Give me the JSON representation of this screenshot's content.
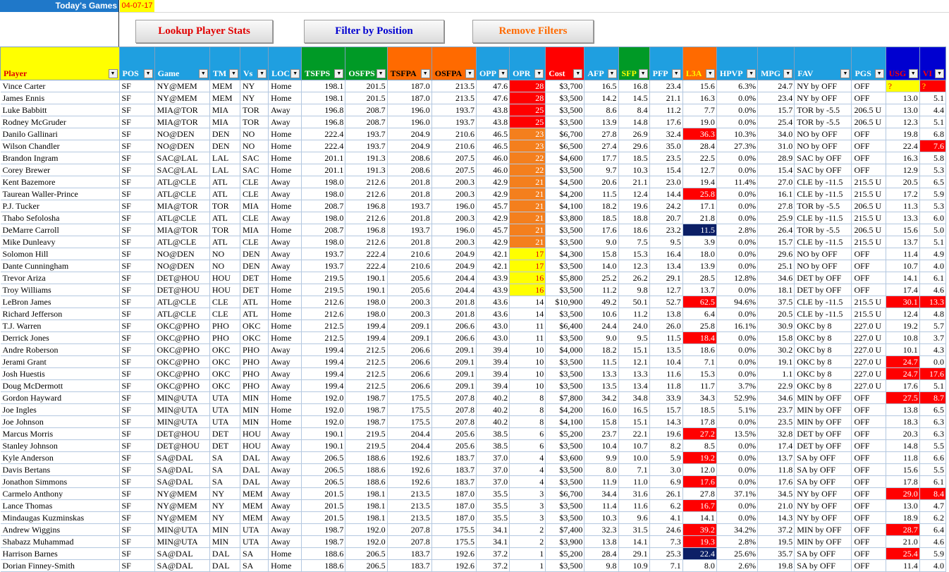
{
  "header": {
    "title": "Today's Games",
    "date": "04-07-17"
  },
  "buttons": {
    "lookup": "Lookup Player Stats",
    "filter": "Filter by Position",
    "remove": "Remove Filters"
  },
  "columns": [
    "Player",
    "POS",
    "Game",
    "TM",
    "Vs",
    "LOC",
    "TSFPS",
    "OSFPS",
    "TSFPA",
    "OSFPA",
    "OPP",
    "OPR",
    "Cost",
    "AFP",
    "SFP",
    "PFP",
    "L3A",
    "HPVP",
    "MPG",
    "FAV",
    "PGS",
    "USG",
    "VI"
  ],
  "column_colors": {
    "yellow": "#ffff00",
    "blue": "#1f9fe0",
    "green": "#009a26",
    "orange": "#ff6a00",
    "red": "#ff0000",
    "navy": "#0000d0"
  },
  "rows": [
    [
      "Vince Carter",
      "SF",
      "NY@MEM",
      "MEM",
      "NY",
      "Home",
      "198.1",
      "201.5",
      "187.0",
      "213.5",
      "47.6",
      "28",
      "$3,700",
      "16.5",
      "16.8",
      "23.4",
      "15.6",
      "6.3%",
      "24.7",
      "NY by OFF",
      "OFF",
      "?",
      "?"
    ],
    [
      "James Ennis",
      "SF",
      "NY@MEM",
      "MEM",
      "NY",
      "Home",
      "198.1",
      "201.5",
      "187.0",
      "213.5",
      "47.6",
      "28",
      "$3,500",
      "14.2",
      "14.5",
      "21.1",
      "16.3",
      "0.0%",
      "23.4",
      "NY by OFF",
      "OFF",
      "13.0",
      "5.1"
    ],
    [
      "Luke Babbitt",
      "SF",
      "MIA@TOR",
      "MIA",
      "TOR",
      "Away",
      "196.8",
      "208.7",
      "196.0",
      "193.7",
      "43.8",
      "25",
      "$3,500",
      "8.6",
      "8.4",
      "11.2",
      "7.7",
      "0.0%",
      "15.7",
      "TOR by -5.5",
      "206.5 U",
      "13.0",
      "4.4"
    ],
    [
      "Rodney McGruder",
      "SF",
      "MIA@TOR",
      "MIA",
      "TOR",
      "Away",
      "196.8",
      "208.7",
      "196.0",
      "193.7",
      "43.8",
      "25",
      "$3,500",
      "13.9",
      "14.8",
      "17.6",
      "19.0",
      "0.0%",
      "25.4",
      "TOR by -5.5",
      "206.5 U",
      "12.3",
      "5.1"
    ],
    [
      "Danilo Gallinari",
      "SF",
      "NO@DEN",
      "DEN",
      "NO",
      "Home",
      "222.4",
      "193.7",
      "204.9",
      "210.6",
      "46.5",
      "23",
      "$6,700",
      "27.8",
      "26.9",
      "32.4",
      "36.3",
      "10.3%",
      "34.0",
      "NO by OFF",
      "OFF",
      "19.8",
      "6.8"
    ],
    [
      "Wilson Chandler",
      "SF",
      "NO@DEN",
      "DEN",
      "NO",
      "Home",
      "222.4",
      "193.7",
      "204.9",
      "210.6",
      "46.5",
      "23",
      "$6,500",
      "27.4",
      "29.6",
      "35.0",
      "28.4",
      "27.3%",
      "31.0",
      "NO by OFF",
      "OFF",
      "22.4",
      "7.6"
    ],
    [
      "Brandon Ingram",
      "SF",
      "SAC@LAL",
      "LAL",
      "SAC",
      "Home",
      "201.1",
      "191.3",
      "208.6",
      "207.5",
      "46.0",
      "22",
      "$4,600",
      "17.7",
      "18.5",
      "23.5",
      "22.5",
      "0.0%",
      "28.9",
      "SAC by OFF",
      "OFF",
      "16.3",
      "5.8"
    ],
    [
      "Corey Brewer",
      "SF",
      "SAC@LAL",
      "LAL",
      "SAC",
      "Home",
      "201.1",
      "191.3",
      "208.6",
      "207.5",
      "46.0",
      "22",
      "$3,500",
      "9.7",
      "10.3",
      "15.4",
      "12.7",
      "0.0%",
      "15.4",
      "SAC by OFF",
      "OFF",
      "12.9",
      "5.3"
    ],
    [
      "Kent Bazemore",
      "SF",
      "ATL@CLE",
      "ATL",
      "CLE",
      "Away",
      "198.0",
      "212.6",
      "201.8",
      "200.3",
      "42.9",
      "21",
      "$4,500",
      "20.6",
      "21.1",
      "23.0",
      "19.4",
      "11.4%",
      "27.0",
      "CLE by -11.5",
      "215.5 U",
      "20.5",
      "6.5"
    ],
    [
      "Taurean Waller-Prince",
      "SF",
      "ATL@CLE",
      "ATL",
      "CLE",
      "Away",
      "198.0",
      "212.6",
      "201.8",
      "200.3",
      "42.9",
      "21",
      "$4,200",
      "11.5",
      "12.4",
      "14.4",
      "25.8",
      "0.0%",
      "16.1",
      "CLE by -11.5",
      "215.5 U",
      "17.2",
      "5.9"
    ],
    [
      "P.J. Tucker",
      "SF",
      "MIA@TOR",
      "TOR",
      "MIA",
      "Home",
      "208.7",
      "196.8",
      "193.7",
      "196.0",
      "45.7",
      "21",
      "$4,100",
      "18.2",
      "19.6",
      "24.2",
      "17.1",
      "0.0%",
      "27.8",
      "TOR by -5.5",
      "206.5 U",
      "11.3",
      "5.3"
    ],
    [
      "Thabo Sefolosha",
      "SF",
      "ATL@CLE",
      "ATL",
      "CLE",
      "Away",
      "198.0",
      "212.6",
      "201.8",
      "200.3",
      "42.9",
      "21",
      "$3,800",
      "18.5",
      "18.8",
      "20.7",
      "21.8",
      "0.0%",
      "25.9",
      "CLE by -11.5",
      "215.5 U",
      "13.3",
      "6.0"
    ],
    [
      "DeMarre Carroll",
      "SF",
      "MIA@TOR",
      "TOR",
      "MIA",
      "Home",
      "208.7",
      "196.8",
      "193.7",
      "196.0",
      "45.7",
      "21",
      "$3,500",
      "17.6",
      "18.6",
      "23.2",
      "11.5",
      "2.8%",
      "26.4",
      "TOR by -5.5",
      "206.5 U",
      "15.6",
      "5.0"
    ],
    [
      "Mike Dunleavy",
      "SF",
      "ATL@CLE",
      "ATL",
      "CLE",
      "Away",
      "198.0",
      "212.6",
      "201.8",
      "200.3",
      "42.9",
      "21",
      "$3,500",
      "9.0",
      "7.5",
      "9.5",
      "3.9",
      "0.0%",
      "15.7",
      "CLE by -11.5",
      "215.5 U",
      "13.7",
      "5.1"
    ],
    [
      "Solomon Hill",
      "SF",
      "NO@DEN",
      "NO",
      "DEN",
      "Away",
      "193.7",
      "222.4",
      "210.6",
      "204.9",
      "42.1",
      "17",
      "$4,300",
      "15.8",
      "15.3",
      "16.4",
      "18.0",
      "0.0%",
      "29.6",
      "NO by OFF",
      "OFF",
      "11.4",
      "4.9"
    ],
    [
      "Dante Cunningham",
      "SF",
      "NO@DEN",
      "NO",
      "DEN",
      "Away",
      "193.7",
      "222.4",
      "210.6",
      "204.9",
      "42.1",
      "17",
      "$3,500",
      "14.0",
      "12.3",
      "13.4",
      "13.9",
      "0.0%",
      "25.1",
      "NO by OFF",
      "OFF",
      "10.7",
      "4.0"
    ],
    [
      "Trevor Ariza",
      "SF",
      "DET@HOU",
      "HOU",
      "DET",
      "Home",
      "219.5",
      "190.1",
      "205.6",
      "204.4",
      "43.9",
      "16",
      "$5,800",
      "25.2",
      "26.2",
      "29.1",
      "28.5",
      "12.8%",
      "34.6",
      "DET by OFF",
      "OFF",
      "14.1",
      "6.1"
    ],
    [
      "Troy Williams",
      "SF",
      "DET@HOU",
      "HOU",
      "DET",
      "Home",
      "219.5",
      "190.1",
      "205.6",
      "204.4",
      "43.9",
      "16",
      "$3,500",
      "11.2",
      "9.8",
      "12.7",
      "13.7",
      "0.0%",
      "18.1",
      "DET by OFF",
      "OFF",
      "17.4",
      "4.6"
    ],
    [
      "LeBron James",
      "SF",
      "ATL@CLE",
      "CLE",
      "ATL",
      "Home",
      "212.6",
      "198.0",
      "200.3",
      "201.8",
      "43.6",
      "14",
      "$10,900",
      "49.2",
      "50.1",
      "52.7",
      "62.5",
      "94.6%",
      "37.5",
      "CLE by -11.5",
      "215.5 U",
      "30.1",
      "13.3"
    ],
    [
      "Richard Jefferson",
      "SF",
      "ATL@CLE",
      "CLE",
      "ATL",
      "Home",
      "212.6",
      "198.0",
      "200.3",
      "201.8",
      "43.6",
      "14",
      "$3,500",
      "10.6",
      "11.2",
      "13.8",
      "6.4",
      "0.0%",
      "20.5",
      "CLE by -11.5",
      "215.5 U",
      "12.4",
      "4.8"
    ],
    [
      "T.J. Warren",
      "SF",
      "OKC@PHO",
      "PHO",
      "OKC",
      "Home",
      "212.5",
      "199.4",
      "209.1",
      "206.6",
      "43.0",
      "11",
      "$6,400",
      "24.4",
      "24.0",
      "26.0",
      "25.8",
      "16.1%",
      "30.9",
      "OKC by 8",
      "227.0 U",
      "19.2",
      "5.7"
    ],
    [
      "Derrick Jones",
      "SF",
      "OKC@PHO",
      "PHO",
      "OKC",
      "Home",
      "212.5",
      "199.4",
      "209.1",
      "206.6",
      "43.0",
      "11",
      "$3,500",
      "9.0",
      "9.5",
      "11.5",
      "18.4",
      "0.0%",
      "15.8",
      "OKC by 8",
      "227.0 U",
      "10.8",
      "3.7"
    ],
    [
      "Andre Roberson",
      "SF",
      "OKC@PHO",
      "OKC",
      "PHO",
      "Away",
      "199.4",
      "212.5",
      "206.6",
      "209.1",
      "39.4",
      "10",
      "$4,000",
      "18.2",
      "15.1",
      "13.5",
      "18.6",
      "0.0%",
      "30.2",
      "OKC by 8",
      "227.0 U",
      "10.1",
      "4.3"
    ],
    [
      "Jerami Grant",
      "SF",
      "OKC@PHO",
      "OKC",
      "PHO",
      "Away",
      "199.4",
      "212.5",
      "206.6",
      "209.1",
      "39.4",
      "10",
      "$3,500",
      "11.5",
      "12.1",
      "10.4",
      "7.1",
      "0.0%",
      "19.1",
      "OKC by 8",
      "227.0 U",
      "24.7",
      "0.0"
    ],
    [
      "Josh Huestis",
      "SF",
      "OKC@PHO",
      "OKC",
      "PHO",
      "Away",
      "199.4",
      "212.5",
      "206.6",
      "209.1",
      "39.4",
      "10",
      "$3,500",
      "13.3",
      "13.3",
      "11.6",
      "15.3",
      "0.0%",
      "1.1",
      "OKC by 8",
      "227.0 U",
      "24.7",
      "17.6"
    ],
    [
      "Doug McDermott",
      "SF",
      "OKC@PHO",
      "OKC",
      "PHO",
      "Away",
      "199.4",
      "212.5",
      "206.6",
      "209.1",
      "39.4",
      "10",
      "$3,500",
      "13.5",
      "13.4",
      "11.8",
      "11.7",
      "3.7%",
      "22.9",
      "OKC by 8",
      "227.0 U",
      "17.6",
      "5.1"
    ],
    [
      "Gordon Hayward",
      "SF",
      "MIN@UTA",
      "UTA",
      "MIN",
      "Home",
      "192.0",
      "198.7",
      "175.5",
      "207.8",
      "40.2",
      "8",
      "$7,800",
      "34.2",
      "34.8",
      "33.9",
      "34.3",
      "52.9%",
      "34.6",
      "MIN by OFF",
      "OFF",
      "27.5",
      "8.7"
    ],
    [
      "Joe Ingles",
      "SF",
      "MIN@UTA",
      "UTA",
      "MIN",
      "Home",
      "192.0",
      "198.7",
      "175.5",
      "207.8",
      "40.2",
      "8",
      "$4,200",
      "16.0",
      "16.5",
      "15.7",
      "18.5",
      "5.1%",
      "23.7",
      "MIN by OFF",
      "OFF",
      "13.8",
      "6.5"
    ],
    [
      "Joe Johnson",
      "SF",
      "MIN@UTA",
      "UTA",
      "MIN",
      "Home",
      "192.0",
      "198.7",
      "175.5",
      "207.8",
      "40.2",
      "8",
      "$4,100",
      "15.8",
      "15.1",
      "14.3",
      "17.8",
      "0.0%",
      "23.5",
      "MIN by OFF",
      "OFF",
      "18.3",
      "6.3"
    ],
    [
      "Marcus Morris",
      "SF",
      "DET@HOU",
      "DET",
      "HOU",
      "Away",
      "190.1",
      "219.5",
      "204.4",
      "205.6",
      "38.5",
      "6",
      "$5,200",
      "23.7",
      "22.1",
      "19.6",
      "27.2",
      "13.5%",
      "32.8",
      "DET by OFF",
      "OFF",
      "20.3",
      "6.3"
    ],
    [
      "Stanley Johnson",
      "SF",
      "DET@HOU",
      "DET",
      "HOU",
      "Away",
      "190.1",
      "219.5",
      "204.4",
      "205.6",
      "38.5",
      "6",
      "$3,500",
      "10.4",
      "10.7",
      "8.2",
      "8.5",
      "0.0%",
      "17.4",
      "DET by OFF",
      "OFF",
      "14.8",
      "5.5"
    ],
    [
      "Kyle Anderson",
      "SF",
      "SA@DAL",
      "SA",
      "DAL",
      "Away",
      "206.5",
      "188.6",
      "192.6",
      "183.7",
      "37.0",
      "4",
      "$3,600",
      "9.9",
      "10.0",
      "5.9",
      "19.2",
      "0.0%",
      "13.7",
      "SA by OFF",
      "OFF",
      "11.8",
      "6.6"
    ],
    [
      "Davis Bertans",
      "SF",
      "SA@DAL",
      "SA",
      "DAL",
      "Away",
      "206.5",
      "188.6",
      "192.6",
      "183.7",
      "37.0",
      "4",
      "$3,500",
      "8.0",
      "7.1",
      "3.0",
      "12.0",
      "0.0%",
      "11.8",
      "SA by OFF",
      "OFF",
      "15.6",
      "5.5"
    ],
    [
      "Jonathon Simmons",
      "SF",
      "SA@DAL",
      "SA",
      "DAL",
      "Away",
      "206.5",
      "188.6",
      "192.6",
      "183.7",
      "37.0",
      "4",
      "$3,500",
      "11.9",
      "11.0",
      "6.9",
      "17.6",
      "0.0%",
      "17.6",
      "SA by OFF",
      "OFF",
      "17.8",
      "6.1"
    ],
    [
      "Carmelo Anthony",
      "SF",
      "NY@MEM",
      "NY",
      "MEM",
      "Away",
      "201.5",
      "198.1",
      "213.5",
      "187.0",
      "35.5",
      "3",
      "$6,700",
      "34.4",
      "31.6",
      "26.1",
      "27.8",
      "37.1%",
      "34.5",
      "NY by OFF",
      "OFF",
      "29.0",
      "8.4"
    ],
    [
      "Lance Thomas",
      "SF",
      "NY@MEM",
      "NY",
      "MEM",
      "Away",
      "201.5",
      "198.1",
      "213.5",
      "187.0",
      "35.5",
      "3",
      "$3,500",
      "11.4",
      "11.6",
      "6.2",
      "16.7",
      "0.0%",
      "21.0",
      "NY by OFF",
      "OFF",
      "13.0",
      "4.7"
    ],
    [
      "Mindaugas Kuzminskas",
      "SF",
      "NY@MEM",
      "NY",
      "MEM",
      "Away",
      "201.5",
      "198.1",
      "213.5",
      "187.0",
      "35.5",
      "3",
      "$3,500",
      "10.3",
      "9.6",
      "4.1",
      "14.1",
      "0.0%",
      "14.3",
      "NY by OFF",
      "OFF",
      "18.9",
      "6.2"
    ],
    [
      "Andrew Wiggins",
      "SF",
      "MIN@UTA",
      "MIN",
      "UTA",
      "Away",
      "198.7",
      "192.0",
      "207.8",
      "175.5",
      "34.1",
      "2",
      "$7,400",
      "32.3",
      "31.5",
      "24.6",
      "39.2",
      "34.2%",
      "37.2",
      "MIN by OFF",
      "OFF",
      "28.7",
      "6.4"
    ],
    [
      "Shabazz Muhammad",
      "SF",
      "MIN@UTA",
      "MIN",
      "UTA",
      "Away",
      "198.7",
      "192.0",
      "207.8",
      "175.5",
      "34.1",
      "2",
      "$3,900",
      "13.8",
      "14.1",
      "7.3",
      "19.3",
      "2.8%",
      "19.5",
      "MIN by OFF",
      "OFF",
      "21.0",
      "4.6"
    ],
    [
      "Harrison Barnes",
      "SF",
      "SA@DAL",
      "DAL",
      "SA",
      "Home",
      "188.6",
      "206.5",
      "183.7",
      "192.6",
      "37.2",
      "1",
      "$5,200",
      "28.4",
      "29.1",
      "25.3",
      "22.4",
      "25.6%",
      "35.7",
      "SA by OFF",
      "OFF",
      "25.4",
      "5.9"
    ],
    [
      "Dorian Finney-Smith",
      "SF",
      "SA@DAL",
      "DAL",
      "SA",
      "Home",
      "188.6",
      "206.5",
      "183.7",
      "192.6",
      "37.2",
      "1",
      "$3,500",
      "9.8",
      "10.9",
      "7.1",
      "8.0",
      "2.6%",
      "19.8",
      "SA by OFF",
      "OFF",
      "11.4",
      "4.0"
    ]
  ]
}
